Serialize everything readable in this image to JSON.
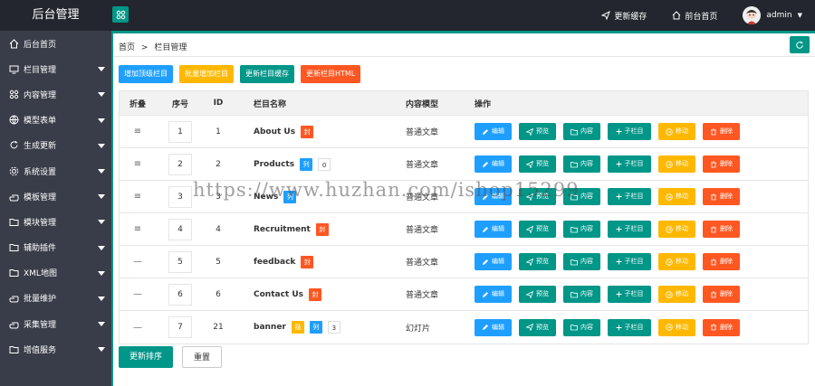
{
  "header": {
    "brand": "后台管理",
    "refresh_cache": "更新缓存",
    "front_home": "前台首页",
    "user": "admin"
  },
  "sidebar": {
    "items": [
      {
        "label": "后台首页",
        "icon": "home-icon",
        "has_submenu": false
      },
      {
        "label": "栏目管理",
        "icon": "monitor-icon",
        "has_submenu": true
      },
      {
        "label": "内容管理",
        "icon": "grid-icon",
        "has_submenu": true
      },
      {
        "label": "模型表单",
        "icon": "globe-icon",
        "has_submenu": true
      },
      {
        "label": "生成更新",
        "icon": "refresh-icon",
        "has_submenu": true
      },
      {
        "label": "系统设置",
        "icon": "gear-icon",
        "has_submenu": true
      },
      {
        "label": "模板管理",
        "icon": "hand-icon",
        "has_submenu": true
      },
      {
        "label": "模块管理",
        "icon": "folder-icon",
        "has_submenu": true
      },
      {
        "label": "辅助插件",
        "icon": "folder-icon",
        "has_submenu": true
      },
      {
        "label": "XML地图",
        "icon": "folder-icon",
        "has_submenu": true
      },
      {
        "label": "批量维护",
        "icon": "hand-icon",
        "has_submenu": true
      },
      {
        "label": "采集管理",
        "icon": "hand-icon",
        "has_submenu": true
      },
      {
        "label": "增值服务",
        "icon": "folder-icon",
        "has_submenu": true
      }
    ]
  },
  "breadcrumb": {
    "home": "首页",
    "sep": ">",
    "current": "栏目管理"
  },
  "toolbar": {
    "add_top": "增加顶级栏目",
    "batch_add": "批量增加栏目",
    "update_cache": "更新栏目缓存",
    "update_html": "更新栏目HTML"
  },
  "table": {
    "headers": {
      "fold": "折叠",
      "order": "序号",
      "id": "ID",
      "name": "栏目名称",
      "model": "内容模型",
      "ops": "操作"
    },
    "op_labels": {
      "edit": "编辑",
      "view": "预览",
      "content": "内容",
      "sub": "子栏目",
      "move": "移动",
      "del": "删除"
    },
    "rows": [
      {
        "fold": "≡",
        "order": "1",
        "id": "1",
        "name": "About Us",
        "badges": [
          {
            "text": "封",
            "color": "#ff5722"
          }
        ],
        "model": "普通文章"
      },
      {
        "fold": "≡",
        "order": "2",
        "id": "2",
        "name": "Products",
        "badges": [
          {
            "text": "列",
            "color": "#1e9fff"
          },
          {
            "text": "0",
            "color": "count"
          }
        ],
        "model": "普通文章"
      },
      {
        "fold": "≡",
        "order": "3",
        "id": "3",
        "name": "News",
        "badges": [
          {
            "text": "列",
            "color": "#1e9fff"
          }
        ],
        "model": "普通文章"
      },
      {
        "fold": "≡",
        "order": "4",
        "id": "4",
        "name": "Recruitment",
        "badges": [
          {
            "text": "封",
            "color": "#ff5722"
          }
        ],
        "model": "普通文章"
      },
      {
        "fold": "—",
        "order": "5",
        "id": "5",
        "name": "feedback",
        "badges": [
          {
            "text": "封",
            "color": "#ff5722"
          }
        ],
        "model": "普通文章"
      },
      {
        "fold": "—",
        "order": "6",
        "id": "6",
        "name": "Contact Us",
        "badges": [
          {
            "text": "封",
            "color": "#ff5722"
          }
        ],
        "model": "普通文章"
      },
      {
        "fold": "—",
        "order": "7",
        "id": "21",
        "name": "banner",
        "badges": [
          {
            "text": "隐",
            "color": "#ffb800"
          },
          {
            "text": "列",
            "color": "#1e9fff"
          },
          {
            "text": "3",
            "color": "count"
          }
        ],
        "model": "幻灯片"
      }
    ]
  },
  "bottom": {
    "update_order": "更新排序",
    "reset": "重置"
  },
  "watermark": "https://www.huzhan.com/ishop15299",
  "colors": {
    "teal": "#009688",
    "blue": "#1e9fff",
    "yellow": "#ffb800",
    "orange": "#ff5722",
    "sidebar": "#393d49",
    "header": "#23262e"
  }
}
